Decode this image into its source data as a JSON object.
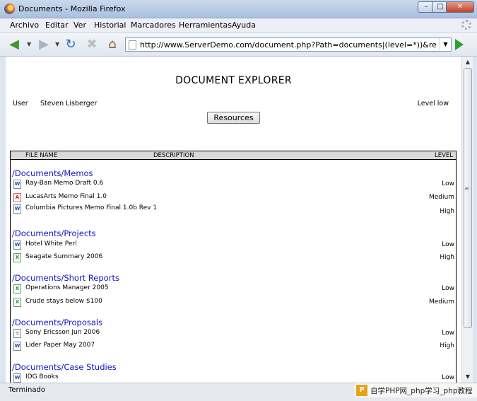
{
  "window": {
    "title": "Documents - Mozilla Firefox",
    "minimize": "–",
    "maximize": "□",
    "close": "✕"
  },
  "menu": [
    "Archivo",
    "Editar",
    "Ver",
    "Historial",
    "Marcadores",
    "Herramientas",
    "Ayuda"
  ],
  "nav": {
    "back_icon": "back-arrow-icon",
    "forward_icon": "forward-arrow-icon",
    "reload_icon": "reload-icon",
    "stop_icon": "stop-icon",
    "home_icon": "home-icon",
    "go_icon": "go-icon",
    "url": "http://www.ServerDemo.com/document.php?Path=documents|(level=*))&recursive=Yes"
  },
  "page": {
    "title": "DOCUMENT EXPLORER",
    "user_label": "User",
    "user_name": "Steven Lisberger",
    "level_info": "Level low",
    "resources_button": "Resources"
  },
  "table": {
    "headers": {
      "file_name": "FILE NAME",
      "description": "DESCRIPTION",
      "level": "LEVEL"
    },
    "groups": [
      {
        "path": "/Documents/Memos",
        "docs": [
          {
            "name": "Ray-Ban Memo Draft 0.6",
            "level": "Low",
            "icon": "word-doc-icon"
          },
          {
            "name": "LucasArts Memo Final 1.0",
            "level": "Medium",
            "icon": "pdf-doc-icon"
          },
          {
            "name": "Columbia Pictures Memo Final 1.0b Rev 1",
            "level": "High",
            "icon": "word-doc-icon"
          }
        ]
      },
      {
        "path": "/Documents/Projects",
        "docs": [
          {
            "name": "Hotel White Perl",
            "level": "Low",
            "icon": "word-doc-icon"
          },
          {
            "name": "Seagate Summary 2006",
            "level": "High",
            "icon": "excel-doc-icon"
          }
        ]
      },
      {
        "path": "/Documents/Short Reports",
        "docs": [
          {
            "name": "Operations Manager 2005",
            "level": "Low",
            "icon": "excel-doc-icon"
          },
          {
            "name": "Crude stays below $100",
            "level": "Medium",
            "icon": "excel-doc-icon"
          }
        ]
      },
      {
        "path": "/Documents/Proposals",
        "docs": [
          {
            "name": "Sony Ericsson Jun 2006",
            "level": "Low",
            "icon": "text-doc-icon"
          },
          {
            "name": "Lider Paper May 2007",
            "level": "High",
            "icon": "word-doc-icon"
          }
        ]
      },
      {
        "path": "/Documents/Case Studies",
        "docs": [
          {
            "name": "IDG Books",
            "level": "Low",
            "icon": "word-doc-icon"
          }
        ]
      }
    ]
  },
  "status": {
    "text": "Terminado"
  },
  "watermark": {
    "logo": "P",
    "text": "自学PHP网_php学习_php教程"
  }
}
